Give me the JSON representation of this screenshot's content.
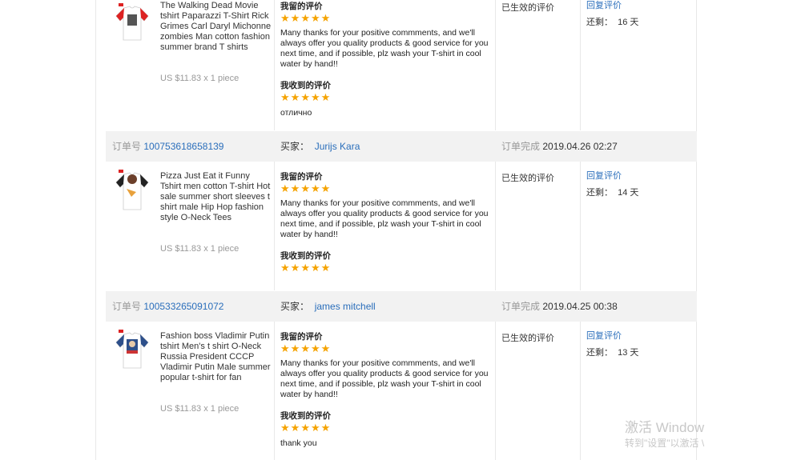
{
  "labels": {
    "order_no": "订单号",
    "buyer": "买家：",
    "completed": "订单完成",
    "my_feedback": "我留的评价",
    "received_feedback": "我收到的评价",
    "status": "已生效的评价",
    "reply": "回复评价",
    "remaining": "还剩："
  },
  "rating_stars": 5,
  "orders": [
    {
      "product_title": "The Walking Dead Movie tshirt Paparazzi T-Shirt Rick Grimes Carl Daryl Michonne zombies Man cotton fashion summer brand T shirts",
      "price": "US $11.83 x 1 piece",
      "my_feedback_text": "Many thanks for your positive commments, and we'll always offer you quality products & good service for you next time, and if possible, plz wash your T-shirt in cool water by hand!!",
      "received_text": "отлично",
      "remaining_days": "16 天"
    },
    {
      "order_no": "100753618658139",
      "buyer": "Jurijs Kara",
      "completed_time": "2019.04.26 02:27",
      "product_title": "Pizza Just Eat it Funny Tshirt men cotton T-shirt Hot sale summer short sleeves t shirt male Hip Hop fashion style O-Neck Tees",
      "price": "US $11.83 x 1 piece",
      "my_feedback_text": "Many thanks for your positive commments, and we'll always offer you quality products & good service for you next time, and if possible, plz wash your T-shirt in cool water by hand!!",
      "received_text": "",
      "remaining_days": "14 天"
    },
    {
      "order_no": "100533265091072",
      "buyer": "james mitchell",
      "completed_time": "2019.04.25 00:38",
      "product_title": "Fashion boss Vladimir Putin tshirt Men's t shirt O-Neck Russia President CCCP Vladimir Putin Male summer popular t-shirt for fan",
      "price": "US $11.83 x 1 piece",
      "my_feedback_text": "Many thanks for your positive commments, and we'll always offer you quality products & good service for you next time, and if possible, plz wash your T-shirt in cool water by hand!!",
      "received_text": "thank you",
      "remaining_days": "13 天"
    }
  ],
  "watermark": {
    "line1": "激活 Window",
    "line2": "转到\"设置\"以激活 \\"
  },
  "colors": {
    "link": "#2a6ebb",
    "star": "#f5a300",
    "header_bg": "#f2f2f2"
  }
}
